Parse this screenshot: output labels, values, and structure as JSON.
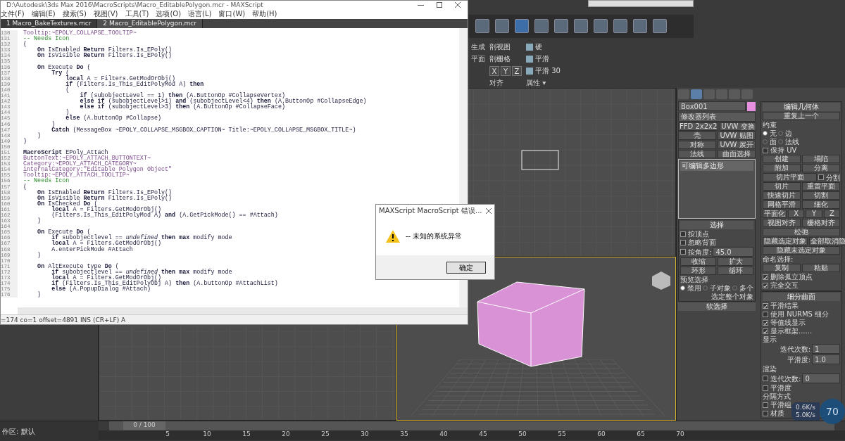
{
  "editor": {
    "title": "D:\\Autodesk\\3ds Max 2016\\MacroScripts\\Macro_EditablePolygon.mcr - MAXScript",
    "menu": [
      "文件(F)",
      "编辑(E)",
      "搜索(S)",
      "视图(V)",
      "工具(T)",
      "选项(O)",
      "语言(L)",
      "窗口(W)",
      "帮助(H)"
    ],
    "tabs": [
      {
        "label": "1 Macro_BakeTextures.mcr",
        "selected": false
      },
      {
        "label": "2 Macro_EditablePolygon.mcr",
        "selected": true
      }
    ],
    "lines": [
      {
        "number": "130",
        "kind": "property",
        "text": "Tooltip:~EPOLY_COLLAPSE_TOOLTIP~"
      },
      {
        "number": "131",
        "kind": "comment",
        "text": "-- Needs Icon"
      },
      {
        "number": "132",
        "kind": "code",
        "text": "("
      },
      {
        "number": "133",
        "kind": "code",
        "text": "    **On** IsEnabled **Return** Filters.Is_EPoly()"
      },
      {
        "number": "134",
        "kind": "code",
        "text": "    **On** IsVisible **Return** Filters.Is_EPoly()"
      },
      {
        "number": "135"
      },
      {
        "number": "136",
        "kind": "code",
        "text": "    **On** Execute **Do** ("
      },
      {
        "number": "137",
        "kind": "code",
        "text": "        **Try** ("
      },
      {
        "number": "138",
        "kind": "code",
        "text": "            **local** A = Filters.GetModOrObj()"
      },
      {
        "number": "139",
        "kind": "code",
        "text": "            **if** (Filters.Is_This_EditPolyMod A) **then**"
      },
      {
        "number": "140",
        "kind": "code",
        "text": "            ("
      },
      {
        "number": "141",
        "kind": "code",
        "text": "                **if** (subobjectLevel == 1) **then** (A.ButtonOp #CollapseVertex)"
      },
      {
        "number": "142",
        "kind": "code",
        "text": "                **else if** (subobjectLevel>1) **and** (subobjectLevel<4) **then** (A.ButtonOp #CollapseEdge)"
      },
      {
        "number": "143",
        "kind": "code",
        "text": "                **else if** (subobjectLevel>3) **then** (A.ButtonOp #CollapseFace)"
      },
      {
        "number": "144",
        "kind": "code",
        "text": "            )"
      },
      {
        "number": "145",
        "kind": "code",
        "text": "            **else** (A.buttonOp #Collapse)"
      },
      {
        "number": "146",
        "kind": "code",
        "text": "        )"
      },
      {
        "number": "147",
        "kind": "code",
        "text": "        **Catch** (MessageBox ~EPOLY_COLLAPSE_MSGBOX_CAPTION~ Title:~EPOLY_COLLAPSE_MSGBOX_TITLE~)"
      },
      {
        "number": "148",
        "kind": "code",
        "text": "    )"
      },
      {
        "number": "149",
        "kind": "code",
        "text": ")"
      },
      {
        "number": "150"
      },
      {
        "number": "151",
        "kind": "code",
        "text": "**MacroScript** EPoly_Attach"
      },
      {
        "number": "152",
        "kind": "property",
        "text": "ButtonText:~EPOLY_ATTACH_BUTTONTEXT~"
      },
      {
        "number": "153",
        "kind": "property",
        "text": "Category:~EPOLY_ATTACH_CATEGORY~"
      },
      {
        "number": "154",
        "kind": "property",
        "text": "internalCategory:\"Editable Polygon Object\""
      },
      {
        "number": "155",
        "kind": "property",
        "text": "Tooltip:~EPOLY_ATTACH_TOOLTIP~"
      },
      {
        "number": "156",
        "kind": "comment",
        "text": "-- Needs Icon"
      },
      {
        "number": "157",
        "kind": "code",
        "text": "("
      },
      {
        "number": "158",
        "kind": "code",
        "text": "    **On** IsEnabled **Return** Filters.Is_EPoly()"
      },
      {
        "number": "159",
        "kind": "code",
        "text": "    **On** IsVisible **Return** Filters.Is_EPoly()"
      },
      {
        "number": "160",
        "kind": "code",
        "text": "    **On** IsChecked **Do** ("
      },
      {
        "number": "161",
        "kind": "code",
        "text": "        **local** A = Filters.GetModOrObj()"
      },
      {
        "number": "162",
        "kind": "code",
        "text": "        (Filters.Is_This_EditPolyMod A) **and** (A.GetPickMode() == #Attach)"
      },
      {
        "number": "163",
        "kind": "code",
        "text": "    )"
      },
      {
        "number": "164"
      },
      {
        "number": "165",
        "kind": "code",
        "text": "    **On** Execute **Do** ("
      },
      {
        "number": "166",
        "kind": "code",
        "text": "        **if** subobjectlevel == *undefined* **then max** modify mode"
      },
      {
        "number": "167",
        "kind": "code",
        "text": "        **local** A = Filters.GetModOrObj()"
      },
      {
        "number": "168",
        "kind": "code",
        "text": "        A.enterPickMode #Attach"
      },
      {
        "number": "169",
        "kind": "code",
        "text": "    )"
      },
      {
        "number": "170"
      },
      {
        "number": "171",
        "kind": "code",
        "text": "    **On** AltExecute type **Do** ("
      },
      {
        "number": "172",
        "kind": "code",
        "text": "        **if** subobjectlevel == *undefined* **then max** modify mode"
      },
      {
        "number": "173",
        "kind": "code",
        "text": "        **local** A = Filters.GetModOrObj()"
      },
      {
        "number": "174",
        "kind": "code",
        "text": "        **if** (Filters.Is_This_EditPolyObj A) **then** (A.buttonOp #AttachList)"
      },
      {
        "number": "175",
        "kind": "code",
        "text": "        **else** (A.PopupDialog #Attach)"
      },
      {
        "number": "176",
        "kind": "code",
        "text": "    )"
      }
    ],
    "status": "=174 co=1 offset=4891 INS (CR+LF) A"
  },
  "dialog": {
    "title": "MAXScript MacroScript 错误...",
    "message": "-- 未知的系统异常",
    "button": "确定"
  },
  "ribbon": {
    "cut_labels": [
      "生成",
      "平面"
    ],
    "view_buttons": [
      "剖视图",
      "剖栅格"
    ],
    "axis_buttons": [
      "X",
      "Y",
      "Z"
    ],
    "smooth_buttons": [
      "硬",
      "平滑",
      "平滑 30"
    ],
    "group_labels": [
      "对齐",
      "属性 ▾"
    ]
  },
  "command_panel": {
    "object_name": "Box001",
    "modifier_list": "修改器列表",
    "modifier_buttons": [
      "FFD 2x2x2",
      "UVW 变换",
      "壳",
      "UVW 贴图",
      "对称",
      "UVW 展开",
      "法线",
      "曲面选择"
    ],
    "stack": [
      {
        "label": "可编辑多边形",
        "selected": true
      }
    ],
    "selection": {
      "title": "选择",
      "checks": [
        {
          "label": "按顶点",
          "checked": false
        },
        {
          "label": "忽略背面",
          "checked": false
        },
        {
          "label": "按角度:",
          "checked": false
        }
      ],
      "angle": "45.0",
      "buttons": [
        "收缩",
        "扩大",
        "环形",
        "循环"
      ],
      "preview_label": "预览选择",
      "preview": [
        {
          "label": "禁用",
          "selected": true
        },
        {
          "label": "子对象",
          "selected": false
        },
        {
          "label": "多个",
          "selected": false
        }
      ],
      "whole": "选定整个对象"
    },
    "soft_selection": "软选择"
  },
  "edit_geometry": {
    "title": "编辑几何体",
    "repeat": "重复上一个",
    "constraint_label": "约束",
    "constraints": [
      {
        "label": "无",
        "selected": true
      },
      {
        "label": "边",
        "selected": false
      },
      {
        "label": "面",
        "selected": false
      },
      {
        "label": "法线",
        "selected": false
      }
    ],
    "rows": [
      [
        {
          "kind": "checkbox",
          "label": "保持 UV",
          "checked": false
        }
      ],
      [
        {
          "kind": "button",
          "label": "创建"
        },
        {
          "kind": "button",
          "label": "塌陷"
        }
      ],
      [
        {
          "kind": "button",
          "label": "附加"
        },
        {
          "kind": "button",
          "label": "分离"
        }
      ],
      [
        {
          "kind": "button",
          "label": "切片平面"
        },
        {
          "kind": "checkbox",
          "label": "分割",
          "checked": false
        }
      ],
      [
        {
          "kind": "button",
          "label": "切片"
        },
        {
          "kind": "button",
          "label": "重置平面"
        }
      ],
      [
        {
          "kind": "button",
          "label": "快速切片"
        },
        {
          "kind": "button",
          "label": "切割"
        }
      ],
      [
        {
          "kind": "button",
          "label": "网格平滑"
        },
        {
          "kind": "button",
          "label": "细化"
        }
      ],
      [
        {
          "kind": "button",
          "label": "平面化"
        },
        {
          "kind": "button",
          "label": "X"
        },
        {
          "kind": "button",
          "label": "Y"
        },
        {
          "kind": "button",
          "label": "Z"
        }
      ],
      [
        {
          "kind": "button",
          "label": "视图对齐"
        },
        {
          "kind": "button",
          "label": "栅格对齐"
        }
      ],
      [
        {
          "kind": "button",
          "label": "松弛"
        }
      ],
      [
        {
          "kind": "button",
          "label": "隐藏选定对象"
        },
        {
          "kind": "button",
          "label": "全部取消隐"
        }
      ],
      [
        {
          "kind": "button",
          "label": "隐藏未选定对象"
        }
      ],
      [
        {
          "kind": "label",
          "label": "命名选择:"
        }
      ],
      [
        {
          "kind": "button",
          "label": "复制"
        },
        {
          "kind": "button",
          "label": "粘贴"
        }
      ],
      [
        {
          "kind": "checkbox",
          "label": "删除孤立顶点",
          "checked": true
        }
      ],
      [
        {
          "kind": "checkbox",
          "label": "完全交互",
          "checked": true
        }
      ]
    ]
  },
  "subdivision": {
    "title": "细分曲面",
    "checks": [
      {
        "label": "平滑结果",
        "checked": true
      },
      {
        "label": "使用 NURMS 细分",
        "checked": false
      },
      {
        "label": "等值线显示",
        "checked": true
      },
      {
        "label": "显示框架......",
        "checked": true
      }
    ],
    "display_label": "显示",
    "display": [
      {
        "label": "迭代次数:",
        "value": "1"
      },
      {
        "label": "平滑度:",
        "value": "1.0"
      }
    ],
    "render_label": "渲染",
    "render": [
      {
        "label": "迭代次数:",
        "value": "0",
        "checked": false
      },
      {
        "label": "平滑度",
        "checked": false
      }
    ],
    "separate_label": "分隔方式",
    "separate": [
      {
        "label": "平滑组",
        "checked": false
      },
      {
        "label": "材质",
        "checked": false
      }
    ]
  },
  "network": {
    "up": "0.6K/s",
    "down": "5.0K/s",
    "percent": "70"
  },
  "workspace": "作区: 默认",
  "timeline": {
    "position": "0 / 100",
    "level": 0,
    "ticks": [
      "5",
      "10",
      "15",
      "20",
      "25",
      "30",
      "35",
      "40",
      "45",
      "50",
      "55",
      "60",
      "65",
      "70"
    ]
  }
}
